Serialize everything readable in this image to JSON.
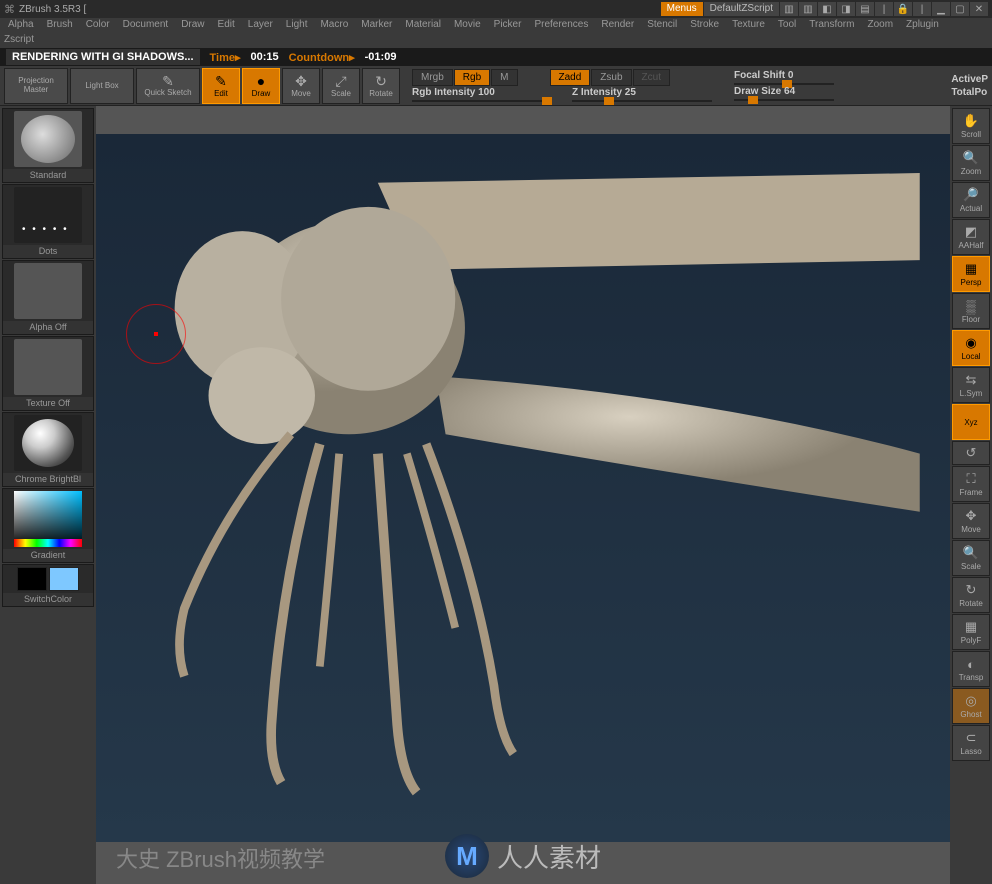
{
  "titlebar": {
    "app_title": "ZBrush 3.5R3 [",
    "menus_btn": "Menus",
    "default_script": "DefaultZScript"
  },
  "menus": [
    "Alpha",
    "Brush",
    "Color",
    "Document",
    "Draw",
    "Edit",
    "Layer",
    "Light",
    "Macro",
    "Marker",
    "Material",
    "Movie",
    "Picker",
    "Preferences",
    "Render",
    "Stencil",
    "Stroke",
    "Texture",
    "Tool",
    "Transform",
    "Zoom",
    "Zplugin",
    "Zscript"
  ],
  "status": {
    "title": "RENDERING WITH GI SHADOWS...",
    "time_label": "Time▸",
    "time_val": "00:15",
    "countdown_label": "Countdown▸",
    "countdown_val": "-01:09"
  },
  "toolbar": {
    "projection": "Projection Master",
    "lightbox": "Light Box",
    "quicksketch": "Quick Sketch",
    "edit": "Edit",
    "draw": "Draw",
    "move": "Move",
    "scale": "Scale",
    "rotate": "Rotate"
  },
  "modes": {
    "mrgb": "Mrgb",
    "rgb": "Rgb",
    "m": "M",
    "zadd": "Zadd",
    "zsub": "Zsub",
    "zcut": "Zcut",
    "rgb_intensity_label": "Rgb Intensity 100",
    "z_intensity_label": "Z Intensity 25",
    "focal_shift": "Focal Shift 0",
    "draw_size": "Draw Size 64"
  },
  "right_status": {
    "active": "ActiveP",
    "total": "TotalPo"
  },
  "left_panel": {
    "brush": "Standard",
    "stroke": "Dots",
    "alpha": "Alpha Off",
    "texture": "Texture Off",
    "material": "Chrome BrightBl",
    "gradient": "Gradient",
    "switchcolor": "SwitchColor"
  },
  "right_panel": {
    "scroll": "Scroll",
    "zoom": "Zoom",
    "actual": "Actual",
    "aahalf": "AAHalf",
    "persp": "Persp",
    "floor": "Floor",
    "local": "Local",
    "lsym": "L.Sym",
    "xyz": "Xyz",
    "frame": "Frame",
    "move": "Move",
    "scale": "Scale",
    "rotate": "Rotate",
    "polyf": "PolyF",
    "transp": "Transp",
    "ghost": "Ghost",
    "lasso": "Lasso"
  },
  "canvas": {
    "subtitle": "大史 ZBrush视频教学",
    "watermark": "人人素材"
  }
}
